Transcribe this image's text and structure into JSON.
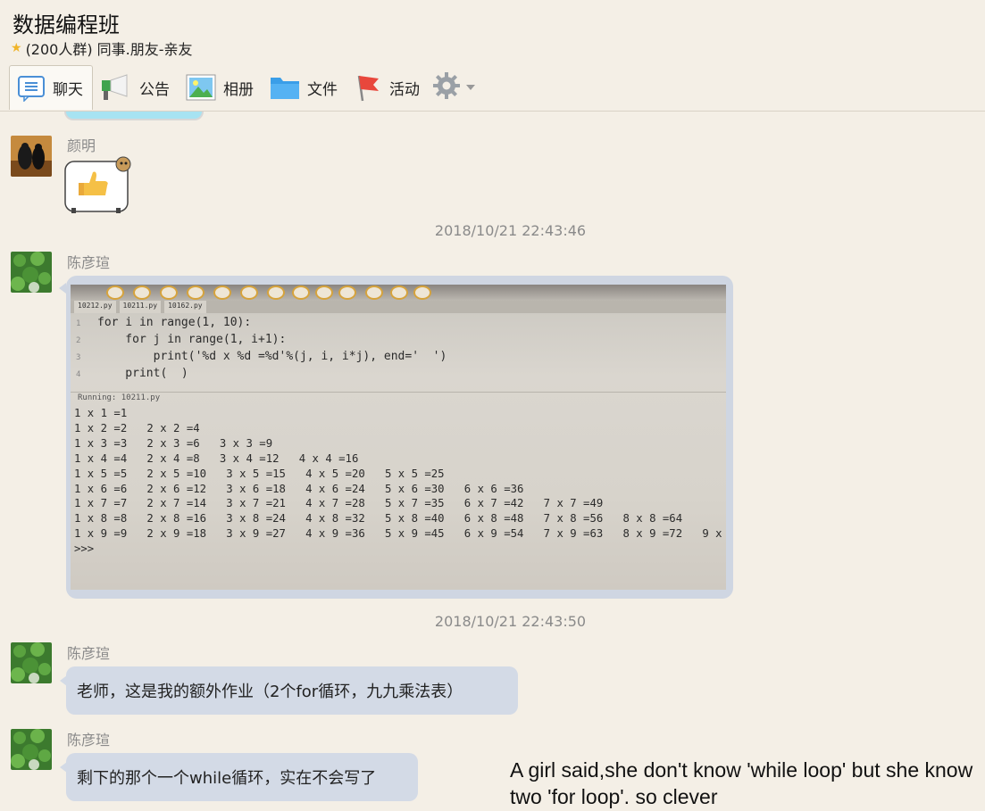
{
  "header": {
    "group_name": "数据编程班",
    "group_info": "(200人群) 同事.朋友-亲友"
  },
  "tabs": [
    {
      "label": "聊天",
      "icon": "chat-icon"
    },
    {
      "label": "公告",
      "icon": "megaphone-icon"
    },
    {
      "label": "相册",
      "icon": "photo-icon"
    },
    {
      "label": "文件",
      "icon": "folder-icon"
    },
    {
      "label": "活动",
      "icon": "flag-icon"
    }
  ],
  "messages": [
    {
      "sender": "颜明",
      "type": "sticker",
      "content": "thumbs-up"
    },
    {
      "timestamp": "2018/10/21 22:43:46"
    },
    {
      "sender": "陈彦瑄",
      "type": "image"
    },
    {
      "timestamp": "2018/10/21 22:43:50"
    },
    {
      "sender": "陈彦瑄",
      "type": "text",
      "text": "老师，这是我的额外作业（2个for循环，九九乘法表）"
    },
    {
      "sender": "陈彦瑄",
      "type": "text",
      "text": "剩下的那个一个while循环，实在不会写了"
    }
  ],
  "photo": {
    "file_tabs": [
      "10212.py",
      "10211.py",
      "10162.py"
    ],
    "code_lines": [
      "for i in range(1, 10):",
      "    for j in range(1, i+1):",
      "        print('%d x %d =%d'%(j, i, i*j), end='  ')",
      "    print(  )"
    ],
    "running_label": "Running: 10211.py",
    "output_lines": [
      "1 x 1 =1",
      "1 x 2 =2   2 x 2 =4",
      "1 x 3 =3   2 x 3 =6   3 x 3 =9",
      "1 x 4 =4   2 x 4 =8   3 x 4 =12   4 x 4 =16",
      "1 x 5 =5   2 x 5 =10   3 x 5 =15   4 x 5 =20   5 x 5 =25",
      "1 x 6 =6   2 x 6 =12   3 x 6 =18   4 x 6 =24   5 x 6 =30   6 x 6 =36",
      "1 x 7 =7   2 x 7 =14   3 x 7 =21   4 x 7 =28   5 x 7 =35   6 x 7 =42   7 x 7 =49",
      "1 x 8 =8   2 x 8 =16   3 x 8 =24   4 x 8 =32   5 x 8 =40   6 x 8 =48   7 x 8 =56   8 x 8 =64",
      "1 x 9 =9   2 x 9 =18   3 x 9 =27   4 x 9 =36   5 x 9 =45   6 x 9 =54   7 x 9 =63   8 x 9 =72   9 x",
      ">>>"
    ]
  },
  "caption": "A girl said,she don't know 'while loop' but she know two 'for loop'. so clever"
}
